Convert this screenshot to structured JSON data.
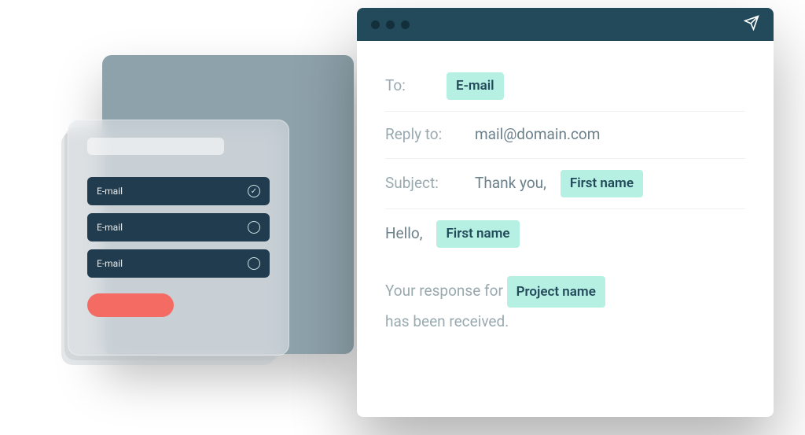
{
  "form_card": {
    "options": [
      {
        "label": "E-mail",
        "checked": true
      },
      {
        "label": "E-mail",
        "checked": false
      },
      {
        "label": "E-mail",
        "checked": false
      }
    ]
  },
  "email": {
    "fields": {
      "to_label": "To:",
      "to_chip": "E-mail",
      "reply_to_label": "Reply to:",
      "reply_to_value": "mail@domain.com",
      "subject_label": "Subject:",
      "subject_prefix": "Thank you,",
      "subject_chip": "First name"
    },
    "greeting_text": "Hello,",
    "greeting_chip": "First name",
    "body_before": "Your response for",
    "body_chip": "Project name",
    "body_after": "has been received."
  }
}
